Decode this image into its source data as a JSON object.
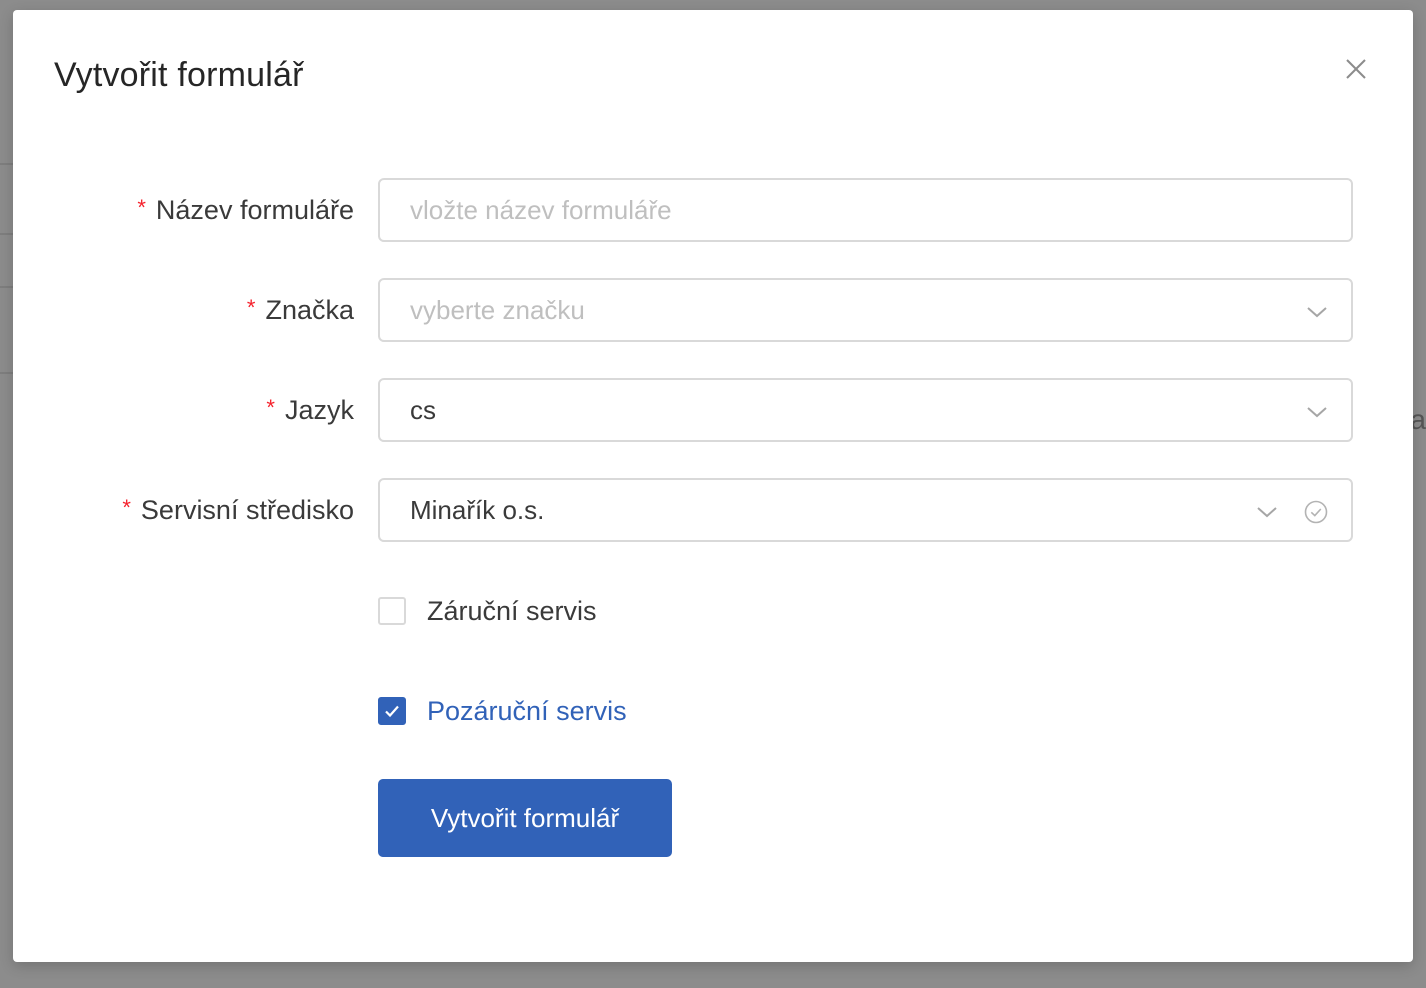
{
  "modal": {
    "title": "Vytvořit formulář"
  },
  "form": {
    "fields": [
      {
        "label": "Název formuláře",
        "required": true,
        "type": "text",
        "placeholder": "vložte název formuláře",
        "value": ""
      },
      {
        "label": "Značka",
        "required": true,
        "type": "select",
        "placeholder": "vyberte značku",
        "value": ""
      },
      {
        "label": "Jazyk",
        "required": true,
        "type": "select",
        "value": "cs"
      },
      {
        "label": "Servisní středisko",
        "required": true,
        "type": "select",
        "value": "Minařík o.s.",
        "icon": "check-circle-icon"
      }
    ],
    "required_marker": "*",
    "checkboxes": [
      {
        "label": "Záruční servis",
        "checked": false
      },
      {
        "label": "Pozáruční servis",
        "checked": true
      }
    ],
    "submit_label": "Vytvořit formulář"
  },
  "background": {
    "edge_text": "a"
  },
  "colors": {
    "primary": "#3162b8",
    "required": "#f5222d",
    "border": "#d9d9d9",
    "placeholder": "#bfbfbf"
  }
}
